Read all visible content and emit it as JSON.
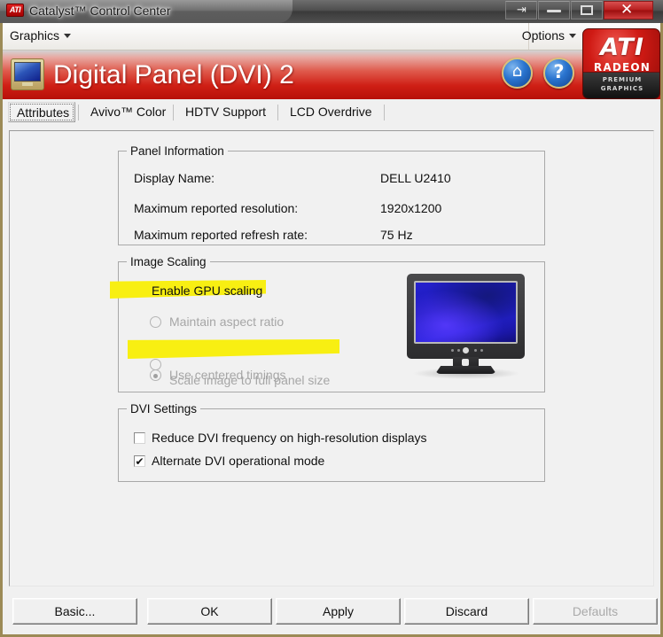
{
  "titlebar": {
    "app_title": "Catalyst™ Control Center",
    "app_icon_text": "ATI",
    "buttons": {
      "detach_glyph": "⇥",
      "close_glyph": "✕"
    }
  },
  "menu": {
    "graphics": "Graphics",
    "options": "Options"
  },
  "banner": {
    "title": "Digital Panel (DVI) 2",
    "home_glyph": "⌂",
    "help_glyph": "?"
  },
  "logo": {
    "brand": "ATI",
    "product": "RADEON",
    "sub_line1": "PREMIUM",
    "sub_line2": "GRAPHICS"
  },
  "tabs": [
    {
      "label": "Attributes",
      "selected": true
    },
    {
      "label": "Avivo™ Color",
      "selected": false
    },
    {
      "label": "HDTV Support",
      "selected": false
    },
    {
      "label": "LCD Overdrive",
      "selected": false
    }
  ],
  "panel_information": {
    "title": "Panel Information",
    "rows": [
      {
        "label": "Display Name:",
        "value": "DELL U2410"
      },
      {
        "label": "Maximum reported resolution:",
        "value": "1920x1200"
      },
      {
        "label": "Maximum reported refresh rate:",
        "value": "75 Hz"
      }
    ]
  },
  "image_scaling": {
    "title": "Image Scaling",
    "enable_gpu_scaling": {
      "label": "Enable GPU scaling",
      "checked": true,
      "highlighted": true
    },
    "radios": [
      {
        "label": "Maintain aspect ratio",
        "selected": false,
        "disabled": true,
        "highlighted": false
      },
      {
        "label": "Scale image to full panel size",
        "selected": true,
        "disabled": true,
        "highlighted": true
      },
      {
        "label": "Use centered timings",
        "selected": false,
        "disabled": true,
        "highlighted": false
      }
    ],
    "check_glyph": "✔"
  },
  "dvi_settings": {
    "title": "DVI Settings",
    "checkboxes": [
      {
        "label": "Reduce DVI frequency on high-resolution displays",
        "checked": false
      },
      {
        "label": "Alternate DVI operational mode",
        "checked": true
      }
    ]
  },
  "footer_buttons": [
    {
      "label": "Basic...",
      "disabled": false
    },
    {
      "label": "OK",
      "disabled": false
    },
    {
      "label": "Apply",
      "disabled": false
    },
    {
      "label": "Discard",
      "disabled": false
    },
    {
      "label": "Defaults",
      "disabled": true
    }
  ],
  "colors": {
    "brand_red": "#cf1f15",
    "highlight_yellow": "#f8ef12",
    "window_border": "#9c8a56",
    "panel_bg": "#f1f1f1",
    "disabled_text": "#a6a6a6"
  }
}
